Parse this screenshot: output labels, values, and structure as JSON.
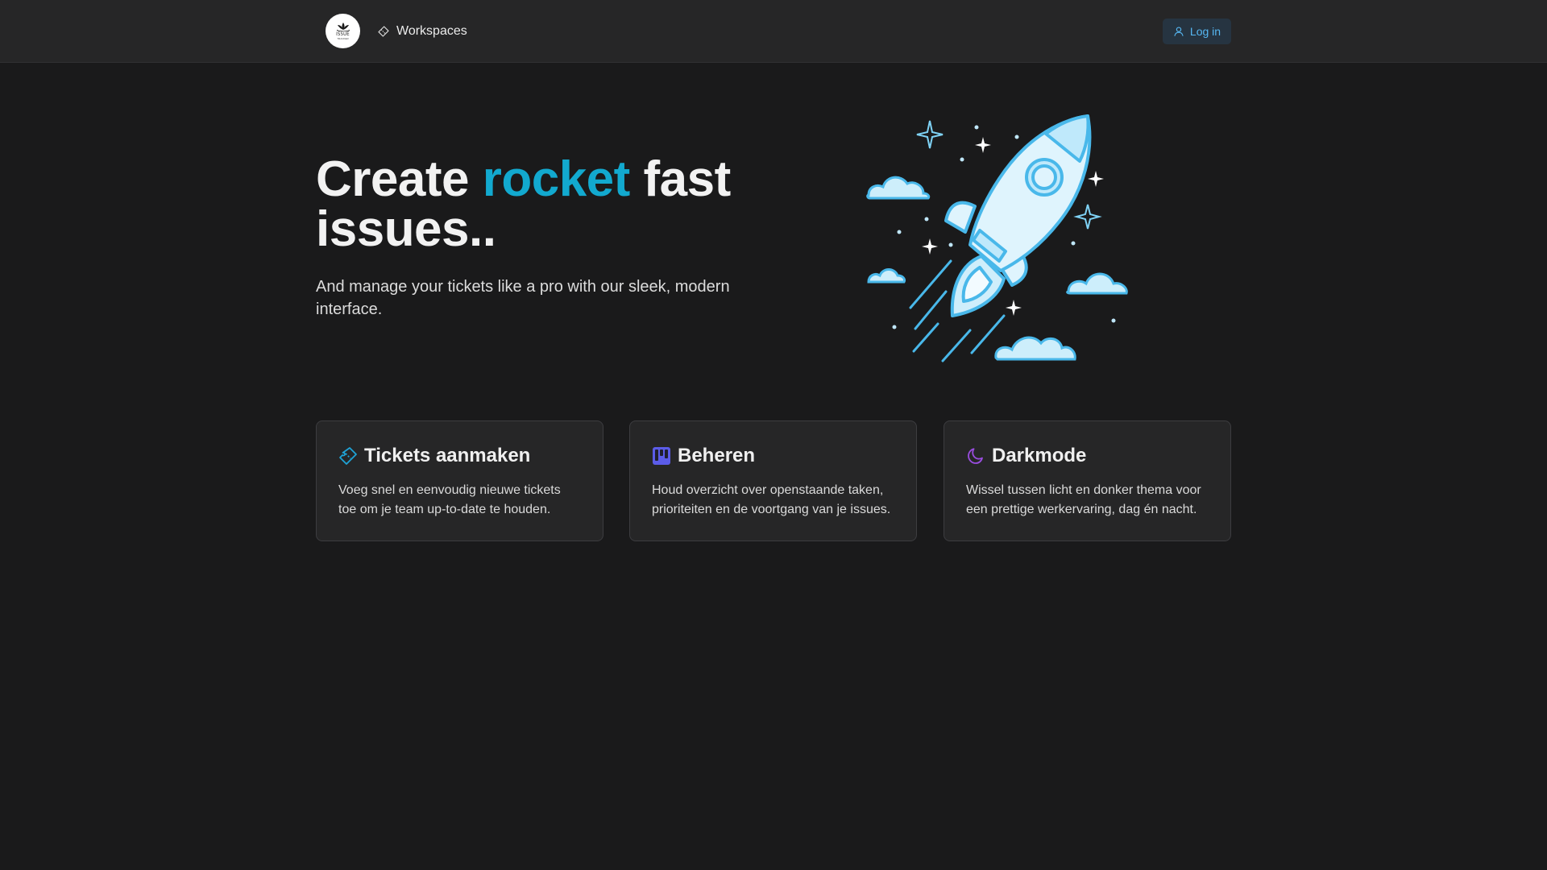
{
  "header": {
    "logo": {
      "text": "ISSUE",
      "subtext": "TRACKER",
      "icon": "lotus-icon"
    },
    "nav": {
      "label": "Workspaces",
      "icon": "ticket-icon"
    },
    "login": {
      "label": "Log in",
      "icon": "user-icon"
    }
  },
  "hero": {
    "title_before": "Create ",
    "title_accent": "rocket",
    "title_after": " fast issues..",
    "subtitle": "And manage your tickets like a pro with our sleek, modern interface.",
    "illustration": "rocket-launch-illustration"
  },
  "features": [
    {
      "title": "Tickets aanmaken",
      "text": "Voeg snel en eenvoudig nieuwe tickets toe om je team up-to-date te houden.",
      "icon": "ticket-icon",
      "icon_color": "#1fa3d6"
    },
    {
      "title": "Beheren",
      "text": "Houd overzicht over openstaande taken, prioriteiten en de voortgang van je issues.",
      "icon": "kanban-icon",
      "icon_color": "#5b5ce8"
    },
    {
      "title": "Darkmode",
      "text": "Wissel tussen licht en donker thema voor een prettige werkervaring, dag én nacht.",
      "icon": "moon-icon",
      "icon_color": "#9a4de0"
    }
  ],
  "colors": {
    "background": "#1a1a1b",
    "navbar": "#262627",
    "accent": "#12a9cf",
    "login_text": "#56b7f2",
    "login_bg": "#263441"
  }
}
